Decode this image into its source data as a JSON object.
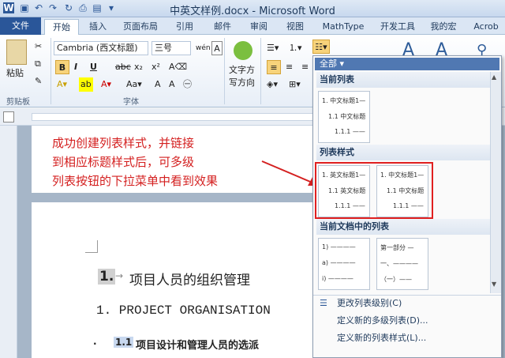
{
  "window": {
    "title": "中英文样例.docx - Microsoft Word"
  },
  "tabs": [
    "文件",
    "开始",
    "插入",
    "页面布局",
    "引用",
    "邮件",
    "审阅",
    "视图",
    "MathType",
    "开发工具",
    "我的宏",
    "Acrob"
  ],
  "ribbon": {
    "paste_label": "粘贴",
    "clipboard_label": "剪贴板",
    "font_label": "字体",
    "font_name": "Cambria (西文标题)",
    "font_size": "三号",
    "bold": "B",
    "italic": "I",
    "underline": "U",
    "strike": "abc",
    "sub": "x₂",
    "sup": "x²",
    "text_direction_label_1": "文字方",
    "text_direction_label_2": "写方向"
  },
  "annotation": [
    "成功创建列表样式，并链接",
    "到相应标题样式后，可多级",
    "列表按钮的下拉菜单中看到效果"
  ],
  "document": {
    "heading1_num": "1.",
    "heading1_text": "项目人员的组织管理",
    "heading1_en": "1. PROJECT ORGANISATION",
    "heading2_num": "1.1",
    "heading2_text": "项目设计和管理人员的选派"
  },
  "dropdown": {
    "filter": "全部",
    "current_list_header": "当前列表",
    "list_styles_header": "列表样式",
    "doc_lists_header": "当前文档中的列表",
    "thumb_current": [
      "1. 中文标题1—",
      "1.1 中文标题",
      "1.1.1 ——"
    ],
    "thumb_style1": [
      "1. 英文标题1—",
      "1.1 英文标题",
      "1.1.1 ——"
    ],
    "thumb_style2": [
      "1. 中文标题1—",
      "1.1 中文标题",
      "1.1.1 ——"
    ],
    "thumb_doc1": [
      "1) ————",
      "a) ————",
      "i) ————"
    ],
    "thumb_doc2": [
      "第一部分 —",
      "一、————",
      "（一）——"
    ],
    "menu": [
      "更改列表级别(C)",
      "定义新的多级列表(D)...",
      "定义新的列表样式(L)..."
    ]
  }
}
